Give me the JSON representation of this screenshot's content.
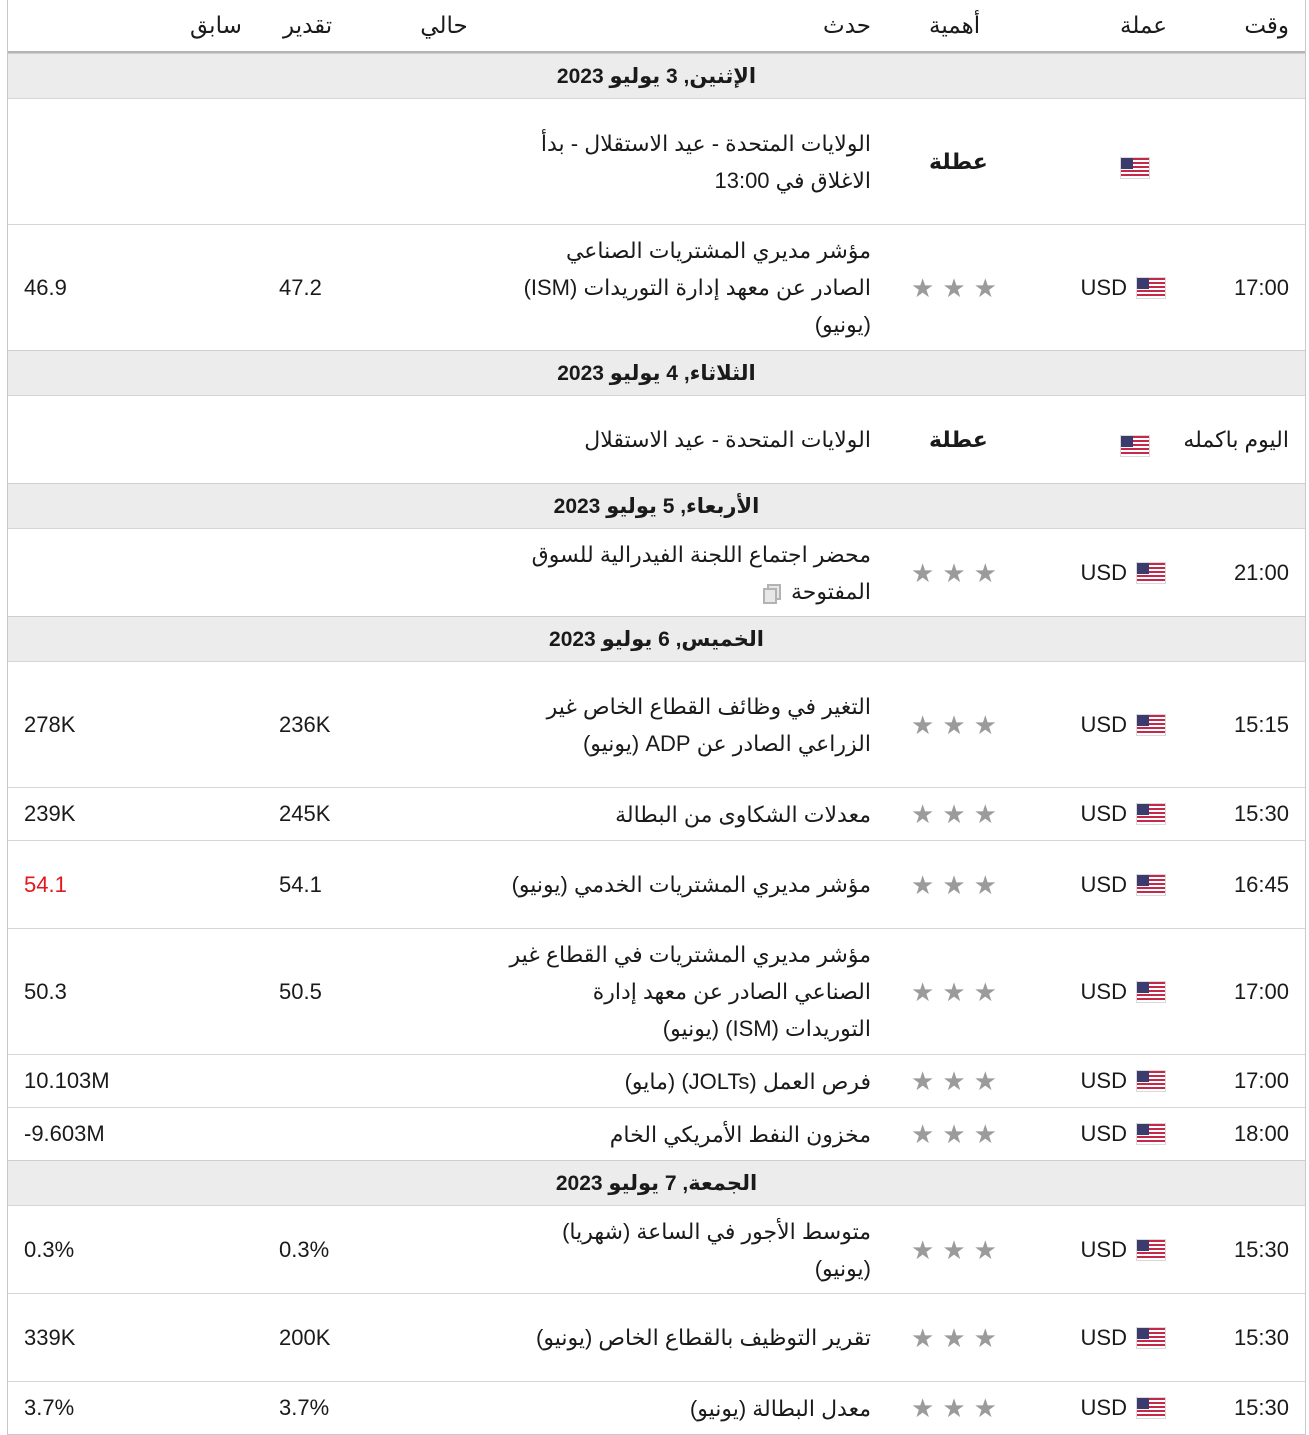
{
  "header": {
    "time": "وقت",
    "currency": "عملة",
    "importance": "أهمية",
    "event": "حدث",
    "actual": "حالي",
    "forecast": "تقدير",
    "previous": "سابق"
  },
  "colors": {
    "negative": "#e0191c",
    "day_bg": "#ececec",
    "star": "#9b9b9b"
  },
  "icons": {
    "flag": "us-flag-icon",
    "star": "star-icon",
    "doc": "document-icon"
  },
  "days": [
    {
      "label": "الإثنين, 3 يوليو 2023",
      "events": [
        {
          "time": "",
          "currency": "",
          "importance": "عطلة",
          "holiday": true,
          "event": "الولايات المتحدة - عيد الاستقلال - بدأ الاغلاق في 13:00",
          "actual": "",
          "forecast": "",
          "previous": ""
        },
        {
          "time": "17:00",
          "currency": "USD",
          "stars": 3,
          "event": "مؤشر مديري المشتريات الصناعي الصادر عن معهد إدارة التوريدات (ISM) (يونيو)",
          "actual": "",
          "forecast": "47.2",
          "previous": "46.9"
        }
      ]
    },
    {
      "label": "الثلاثاء, 4 يوليو 2023",
      "events": [
        {
          "time": "اليوم باكمله",
          "currency": "",
          "importance": "عطلة",
          "holiday": true,
          "event": "الولايات المتحدة - عيد الاستقلال",
          "actual": "",
          "forecast": "",
          "previous": ""
        }
      ]
    },
    {
      "label": "الأربعاء, 5 يوليو 2023",
      "events": [
        {
          "time": "21:00",
          "currency": "USD",
          "stars": 3,
          "event": "محضر اجتماع اللجنة الفيدرالية للسوق المفتوحة",
          "doc": true,
          "actual": "",
          "forecast": "",
          "previous": ""
        }
      ]
    },
    {
      "label": "الخميس, 6 يوليو 2023",
      "events": [
        {
          "time": "15:15",
          "currency": "USD",
          "stars": 3,
          "event": "التغير في وظائف القطاع الخاص غير الزراعي الصادر عن ADP (يونيو)",
          "actual": "",
          "forecast": "236K",
          "previous": "278K"
        },
        {
          "time": "15:30",
          "currency": "USD",
          "stars": 3,
          "event": "معدلات الشكاوى من البطالة",
          "actual": "",
          "forecast": "245K",
          "previous": "239K"
        },
        {
          "time": "16:45",
          "currency": "USD",
          "stars": 3,
          "event": "مؤشر مديري المشتريات الخدمي (يونيو)",
          "actual": "",
          "forecast": "54.1",
          "previous": "54.1",
          "previous_red": true
        },
        {
          "time": "17:00",
          "currency": "USD",
          "stars": 3,
          "event": "مؤشر مديري المشتريات في القطاع غير الصناعي الصادر عن معهد إدارة التوريدات (ISM) (يونيو)",
          "actual": "",
          "forecast": "50.5",
          "previous": "50.3"
        },
        {
          "time": "17:00",
          "currency": "USD",
          "stars": 3,
          "event": "فرص العمل (JOLTs) (مايو)",
          "actual": "",
          "forecast": "",
          "previous": "10.103M"
        },
        {
          "time": "18:00",
          "currency": "USD",
          "stars": 3,
          "event": "مخزون النفط الأمريكي الخام",
          "actual": "",
          "forecast": "",
          "previous": "-9.603M"
        }
      ]
    },
    {
      "label": "الجمعة, 7 يوليو 2023",
      "events": [
        {
          "time": "15:30",
          "currency": "USD",
          "stars": 3,
          "event": "متوسط الأجور في الساعة (شهريا) (يونيو)",
          "actual": "",
          "forecast": "0.3%",
          "previous": "0.3%"
        },
        {
          "time": "15:30",
          "currency": "USD",
          "stars": 3,
          "event": "تقرير التوظيف بالقطاع الخاص (يونيو)",
          "actual": "",
          "forecast": "200K",
          "previous": "339K"
        },
        {
          "time": "15:30",
          "currency": "USD",
          "stars": 3,
          "event": "معدل البطالة (يونيو)",
          "actual": "",
          "forecast": "3.7%",
          "previous": "3.7%"
        }
      ]
    }
  ]
}
